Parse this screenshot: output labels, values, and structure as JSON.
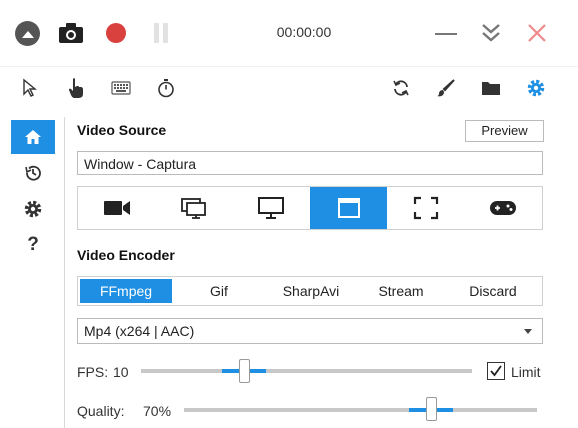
{
  "window": {
    "timer": "00:00:00",
    "icons": {
      "collapse": "chevron-up-circle-icon",
      "camera": "camera-icon",
      "record": "record-icon",
      "pause": "pause-icon",
      "minimize": "minimize-icon",
      "expand": "double-chevron-down-icon",
      "close": "close-icon"
    },
    "record_color": "#d8413d",
    "close_color": "#f08a8a"
  },
  "toolbar": {
    "left": [
      "cursor-icon",
      "hand-pointer-icon",
      "keyboard-icon",
      "stopwatch-icon"
    ],
    "right": [
      "refresh-icon",
      "brush-icon",
      "folder-icon",
      "gear-icon"
    ]
  },
  "sidebar": {
    "items": [
      "home-icon",
      "history-icon",
      "gear-icon",
      "help-icon"
    ],
    "help_label": "?"
  },
  "video_source": {
    "title": "Video Source",
    "preview_label": "Preview",
    "current_source": "Window  -  Captura",
    "types": [
      "video-camera-icon",
      "screens-icon",
      "monitor-icon",
      "window-icon",
      "fullscreen-region-icon",
      "gamepad-icon"
    ],
    "selected_index": 3
  },
  "video_encoder": {
    "title": "Video Encoder",
    "tabs": [
      "FFmpeg",
      "Gif",
      "SharpAvi",
      "Stream",
      "Discard"
    ],
    "selected_tab": "FFmpeg",
    "format": "Mp4 (x264 | AAC)"
  },
  "fps": {
    "label": "FPS:",
    "value": "10",
    "slider_fraction": 0.31,
    "limit_label": "Limit",
    "limit_checked": true
  },
  "quality": {
    "label": "Quality:",
    "value": "70%",
    "slider_fraction": 0.7
  },
  "accent_color": "#1e8fe3"
}
